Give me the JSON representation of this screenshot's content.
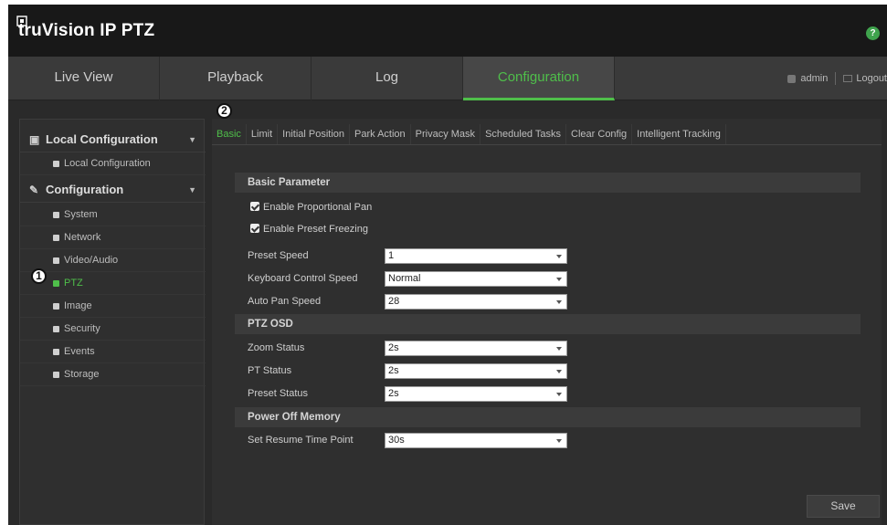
{
  "app": {
    "logo": "truVision IP PTZ"
  },
  "nav": {
    "tabs": [
      "Live View",
      "Playback",
      "Log",
      "Configuration"
    ],
    "user": "admin",
    "logout": "Logout"
  },
  "sidebar": {
    "local_group": "Local Configuration",
    "local_items": [
      "Local Configuration"
    ],
    "config_group": "Configuration",
    "config_items": [
      "System",
      "Network",
      "Video/Audio",
      "PTZ",
      "Image",
      "Security",
      "Events",
      "Storage"
    ]
  },
  "callouts": [
    "1",
    "2"
  ],
  "subtabs": [
    "Basic",
    "Limit",
    "Initial Position",
    "Park Action",
    "Privacy Mask",
    "Scheduled Tasks",
    "Clear Config",
    "Intelligent Tracking"
  ],
  "form": {
    "basic_parameter": "Basic Parameter",
    "enable_proportional_pan": "Enable Proportional Pan",
    "enable_preset_freezing": "Enable Preset Freezing",
    "preset_speed_label": "Preset Speed",
    "preset_speed_value": "1",
    "keyboard_speed_label": "Keyboard Control Speed",
    "keyboard_speed_value": "Normal",
    "auto_pan_label": "Auto Pan Speed",
    "auto_pan_value": "28",
    "ptz_osd": "PTZ OSD",
    "zoom_status_label": "Zoom Status",
    "zoom_status_value": "2s",
    "pt_status_label": "PT Status",
    "pt_status_value": "2s",
    "preset_status_label": "Preset Status",
    "preset_status_value": "2s",
    "power_off_memory": "Power Off Memory",
    "resume_label": "Set Resume Time Point",
    "resume_value": "30s",
    "save": "Save"
  },
  "colors": {
    "accent": "#4fbf4a",
    "help": "#3fa34d"
  },
  "icons": [
    "logo-icon",
    "help-icon",
    "user-icon",
    "logout-icon",
    "local-config-icon",
    "wrench-icon",
    "chevron-down-icon",
    "dropdown-caret-icon"
  ]
}
